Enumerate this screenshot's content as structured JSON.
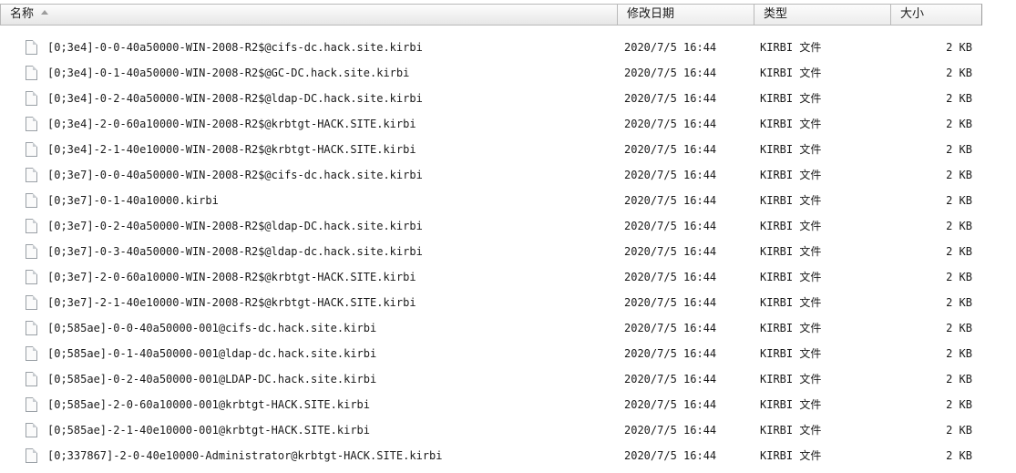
{
  "columns": {
    "name": "名称",
    "date": "修改日期",
    "type": "类型",
    "size": "大小"
  },
  "files": [
    {
      "name": "[0;3e4]-0-0-40a50000-WIN-2008-R2$@cifs-dc.hack.site.kirbi",
      "date": "2020/7/5 16:44",
      "type": "KIRBI 文件",
      "size": "2 KB"
    },
    {
      "name": "[0;3e4]-0-1-40a50000-WIN-2008-R2$@GC-DC.hack.site.kirbi",
      "date": "2020/7/5 16:44",
      "type": "KIRBI 文件",
      "size": "2 KB"
    },
    {
      "name": "[0;3e4]-0-2-40a50000-WIN-2008-R2$@ldap-DC.hack.site.kirbi",
      "date": "2020/7/5 16:44",
      "type": "KIRBI 文件",
      "size": "2 KB"
    },
    {
      "name": "[0;3e4]-2-0-60a10000-WIN-2008-R2$@krbtgt-HACK.SITE.kirbi",
      "date": "2020/7/5 16:44",
      "type": "KIRBI 文件",
      "size": "2 KB"
    },
    {
      "name": "[0;3e4]-2-1-40e10000-WIN-2008-R2$@krbtgt-HACK.SITE.kirbi",
      "date": "2020/7/5 16:44",
      "type": "KIRBI 文件",
      "size": "2 KB"
    },
    {
      "name": "[0;3e7]-0-0-40a50000-WIN-2008-R2$@cifs-dc.hack.site.kirbi",
      "date": "2020/7/5 16:44",
      "type": "KIRBI 文件",
      "size": "2 KB"
    },
    {
      "name": "[0;3e7]-0-1-40a10000.kirbi",
      "date": "2020/7/5 16:44",
      "type": "KIRBI 文件",
      "size": "2 KB"
    },
    {
      "name": "[0;3e7]-0-2-40a50000-WIN-2008-R2$@ldap-DC.hack.site.kirbi",
      "date": "2020/7/5 16:44",
      "type": "KIRBI 文件",
      "size": "2 KB"
    },
    {
      "name": "[0;3e7]-0-3-40a50000-WIN-2008-R2$@ldap-dc.hack.site.kirbi",
      "date": "2020/7/5 16:44",
      "type": "KIRBI 文件",
      "size": "2 KB"
    },
    {
      "name": "[0;3e7]-2-0-60a10000-WIN-2008-R2$@krbtgt-HACK.SITE.kirbi",
      "date": "2020/7/5 16:44",
      "type": "KIRBI 文件",
      "size": "2 KB"
    },
    {
      "name": "[0;3e7]-2-1-40e10000-WIN-2008-R2$@krbtgt-HACK.SITE.kirbi",
      "date": "2020/7/5 16:44",
      "type": "KIRBI 文件",
      "size": "2 KB"
    },
    {
      "name": "[0;585ae]-0-0-40a50000-001@cifs-dc.hack.site.kirbi",
      "date": "2020/7/5 16:44",
      "type": "KIRBI 文件",
      "size": "2 KB"
    },
    {
      "name": "[0;585ae]-0-1-40a50000-001@ldap-dc.hack.site.kirbi",
      "date": "2020/7/5 16:44",
      "type": "KIRBI 文件",
      "size": "2 KB"
    },
    {
      "name": "[0;585ae]-0-2-40a50000-001@LDAP-DC.hack.site.kirbi",
      "date": "2020/7/5 16:44",
      "type": "KIRBI 文件",
      "size": "2 KB"
    },
    {
      "name": "[0;585ae]-2-0-60a10000-001@krbtgt-HACK.SITE.kirbi",
      "date": "2020/7/5 16:44",
      "type": "KIRBI 文件",
      "size": "2 KB"
    },
    {
      "name": "[0;585ae]-2-1-40e10000-001@krbtgt-HACK.SITE.kirbi",
      "date": "2020/7/5 16:44",
      "type": "KIRBI 文件",
      "size": "2 KB"
    },
    {
      "name": "[0;337867]-2-0-40e10000-Administrator@krbtgt-HACK.SITE.kirbi",
      "date": "2020/7/5 16:44",
      "type": "KIRBI 文件",
      "size": "2 KB"
    }
  ],
  "icons": {
    "sort": "sort-ascending-icon",
    "file": "file-icon"
  }
}
